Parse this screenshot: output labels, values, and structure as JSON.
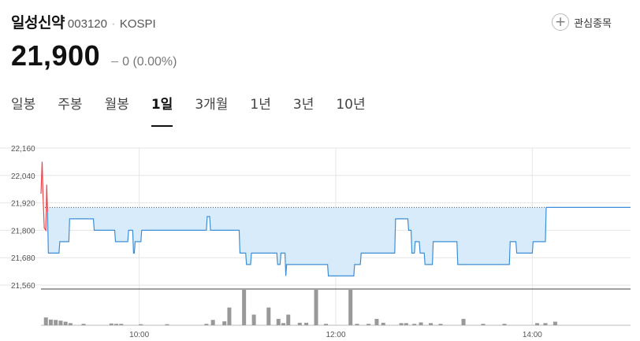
{
  "stock": {
    "name": "일성신약",
    "code": "003120",
    "separator": "·",
    "market": "KOSPI",
    "price": "21,900",
    "change_icon": "flat-dash-icon",
    "change": "0 (0.00%)",
    "favorite_label": "관심종목",
    "favorite_icon": "plus-icon"
  },
  "tabs": [
    {
      "label": "일봉",
      "active": false
    },
    {
      "label": "주봉",
      "active": false
    },
    {
      "label": "월봉",
      "active": false
    },
    {
      "label": "1일",
      "active": true
    },
    {
      "label": "3개월",
      "active": false
    },
    {
      "label": "1년",
      "active": false
    },
    {
      "label": "3년",
      "active": false
    },
    {
      "label": "10년",
      "active": false
    }
  ],
  "colors": {
    "line": "#3d8fd8",
    "fill": "#d8ebfb",
    "up": "#e8464c",
    "volume": "#999999",
    "grid": "#e6e6e6"
  },
  "chart_data": {
    "type": "area",
    "yticks": [
      "22,160",
      "22,040",
      "21,920",
      "21,800",
      "21,680",
      "21,560"
    ],
    "ytick_values": [
      22160,
      22040,
      21920,
      21800,
      21680,
      21560
    ],
    "ylim": [
      21560,
      22160
    ],
    "xticks": [
      "10:00",
      "12:00",
      "14:00"
    ],
    "xtick_minutes": [
      600,
      720,
      840
    ],
    "xlim": [
      540,
      900
    ],
    "reference": 21900,
    "grid": true,
    "up_segment": [
      [
        540,
        21960
      ],
      [
        540.7,
        22100
      ],
      [
        541.3,
        21940
      ],
      [
        542,
        21810
      ],
      [
        543,
        21800
      ],
      [
        543.5,
        22000
      ],
      [
        544,
        21880
      ]
    ],
    "series": [
      [
        544,
        21880
      ],
      [
        544.5,
        21700
      ],
      [
        551,
        21700
      ],
      [
        551.5,
        21750
      ],
      [
        557,
        21750
      ],
      [
        557.5,
        21850
      ],
      [
        572,
        21850
      ],
      [
        572.5,
        21800
      ],
      [
        585,
        21800
      ],
      [
        585.5,
        21750
      ],
      [
        593,
        21750
      ],
      [
        593.5,
        21800
      ],
      [
        596,
        21800
      ],
      [
        596.5,
        21700
      ],
      [
        597,
        21700
      ],
      [
        597.5,
        21750
      ],
      [
        601,
        21750
      ],
      [
        601.5,
        21800
      ],
      [
        641,
        21800
      ],
      [
        641.5,
        21860
      ],
      [
        643,
        21860
      ],
      [
        643.5,
        21800
      ],
      [
        661,
        21800
      ],
      [
        661.5,
        21700
      ],
      [
        665,
        21700
      ],
      [
        665.5,
        21650
      ],
      [
        668,
        21650
      ],
      [
        668.5,
        21700
      ],
      [
        684,
        21700
      ],
      [
        684.5,
        21650
      ],
      [
        686,
        21650
      ],
      [
        686.5,
        21700
      ],
      [
        689,
        21700
      ],
      [
        689.5,
        21600
      ],
      [
        690,
        21650
      ],
      [
        715,
        21650
      ],
      [
        715.5,
        21600
      ],
      [
        731,
        21600
      ],
      [
        731.5,
        21650
      ],
      [
        735,
        21650
      ],
      [
        735.5,
        21700
      ],
      [
        756,
        21700
      ],
      [
        756.5,
        21850
      ],
      [
        764,
        21850
      ],
      [
        764.5,
        21800
      ],
      [
        766,
        21800
      ],
      [
        766.5,
        21700
      ],
      [
        768,
        21700
      ],
      [
        768.5,
        21750
      ],
      [
        771,
        21750
      ],
      [
        771.5,
        21700
      ],
      [
        774,
        21700
      ],
      [
        774.5,
        21650
      ],
      [
        779,
        21650
      ],
      [
        779.5,
        21750
      ],
      [
        794,
        21750
      ],
      [
        794.5,
        21650
      ],
      [
        826,
        21650
      ],
      [
        826.5,
        21750
      ],
      [
        830,
        21750
      ],
      [
        830.5,
        21700
      ],
      [
        840,
        21700
      ],
      [
        840.5,
        21750
      ],
      [
        848,
        21750
      ],
      [
        848.5,
        21900
      ],
      [
        900,
        21900
      ]
    ],
    "volume_ylim": [
      0,
      100
    ],
    "volume": [
      [
        543,
        22
      ],
      [
        546,
        16
      ],
      [
        549,
        15
      ],
      [
        552,
        13
      ],
      [
        555,
        10
      ],
      [
        558,
        6
      ],
      [
        566,
        4
      ],
      [
        583,
        5
      ],
      [
        586,
        4
      ],
      [
        589,
        4
      ],
      [
        601,
        3
      ],
      [
        617,
        3
      ],
      [
        641,
        4
      ],
      [
        645,
        15
      ],
      [
        652,
        11
      ],
      [
        655,
        50
      ],
      [
        664,
        100
      ],
      [
        670,
        30
      ],
      [
        679,
        50
      ],
      [
        685,
        18
      ],
      [
        688,
        6
      ],
      [
        691,
        30
      ],
      [
        698,
        7
      ],
      [
        702,
        7
      ],
      [
        708,
        100
      ],
      [
        714,
        4
      ],
      [
        729,
        100
      ],
      [
        733,
        4
      ],
      [
        740,
        4
      ],
      [
        745,
        18
      ],
      [
        749,
        7
      ],
      [
        760,
        6
      ],
      [
        763,
        6
      ],
      [
        768,
        4
      ],
      [
        772,
        8
      ],
      [
        778,
        6
      ],
      [
        784,
        4
      ],
      [
        798,
        18
      ],
      [
        810,
        4
      ],
      [
        823,
        4
      ],
      [
        843,
        6
      ],
      [
        848,
        6
      ],
      [
        854,
        10
      ]
    ]
  }
}
